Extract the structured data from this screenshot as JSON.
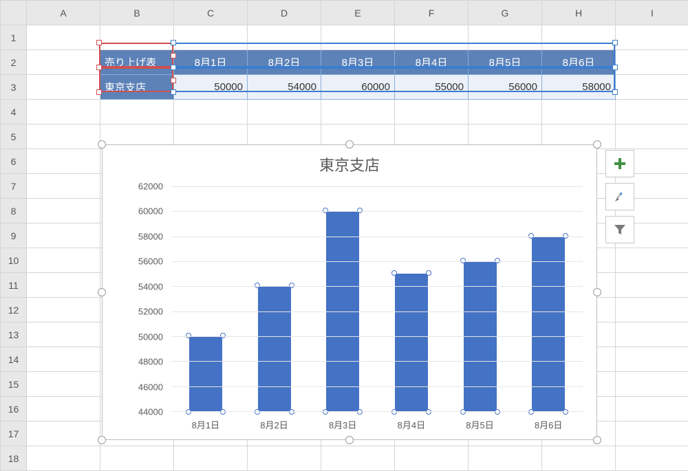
{
  "columns": [
    "A",
    "B",
    "C",
    "D",
    "E",
    "F",
    "G",
    "H",
    "I"
  ],
  "rows_visible": 18,
  "table": {
    "header_label": "売り上げ表",
    "dates": [
      "8月1日",
      "8月2日",
      "8月3日",
      "8月4日",
      "8月5日",
      "8月6日"
    ],
    "row_label": "東京支店",
    "values": [
      50000,
      54000,
      60000,
      55000,
      56000,
      58000
    ]
  },
  "chart_data": {
    "type": "bar",
    "title": "東京支店",
    "categories": [
      "8月1日",
      "8月2日",
      "8月3日",
      "8月4日",
      "8月5日",
      "8月6日"
    ],
    "values": [
      50000,
      54000,
      60000,
      55000,
      56000,
      58000
    ],
    "ylim": [
      44000,
      62000
    ],
    "yticks": [
      44000,
      46000,
      48000,
      50000,
      52000,
      54000,
      56000,
      58000,
      60000,
      62000
    ],
    "xlabel": "",
    "ylabel": ""
  },
  "side_buttons": {
    "plus": "chart-elements",
    "brush": "chart-styles",
    "filter": "chart-filters"
  }
}
